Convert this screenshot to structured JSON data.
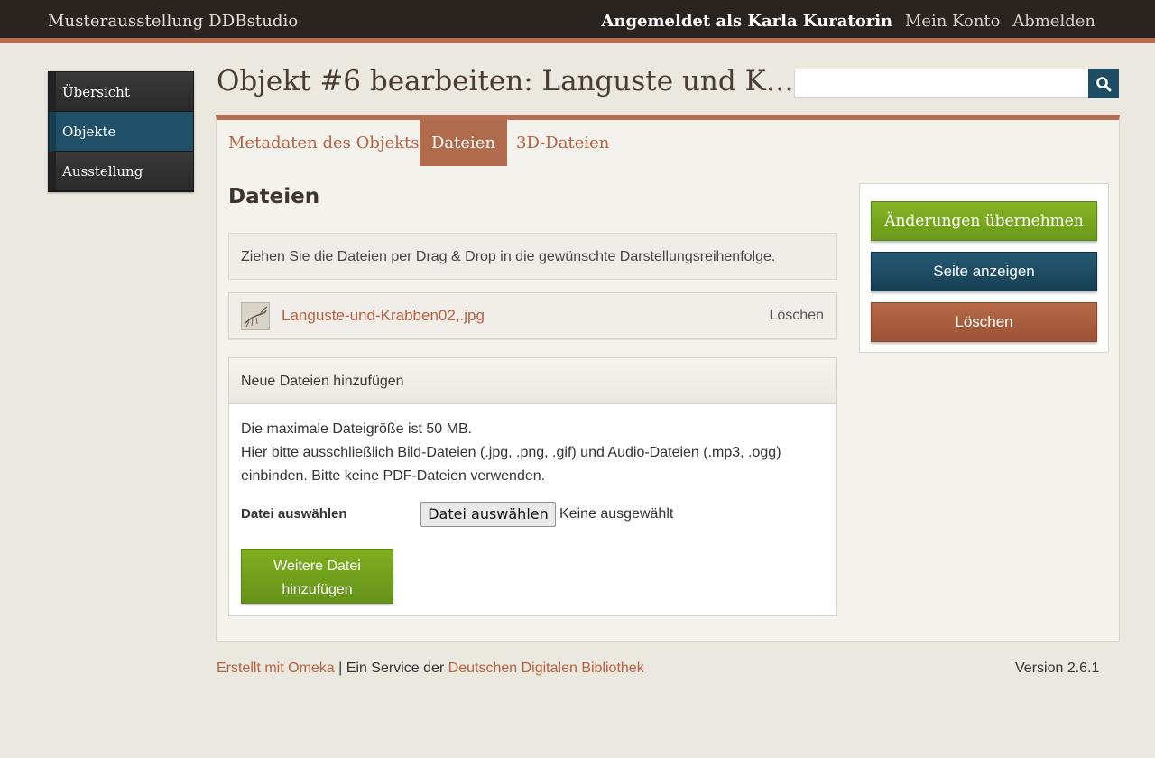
{
  "header": {
    "site_title": "Musterausstellung DDBstudio",
    "logged_in": "Angemeldet als Karla Kuratorin",
    "account": "Mein Konto",
    "logout": "Abmelden"
  },
  "sidebar": {
    "items": [
      {
        "label": "Übersicht",
        "active": false
      },
      {
        "label": "Objekte",
        "active": true
      },
      {
        "label": "Ausstellung",
        "active": false
      }
    ]
  },
  "page": {
    "title": "Objekt #6 bearbeiten: Languste und K…",
    "search_placeholder": ""
  },
  "tabs": [
    {
      "label": "Metadaten des Objekts",
      "active": false
    },
    {
      "label": "Dateien",
      "active": true
    },
    {
      "label": "3D-Dateien",
      "active": false
    }
  ],
  "files": {
    "heading": "Dateien",
    "notice": "Ziehen Sie die Dateien per Drag & Drop in die gewünschte Darstellungsreihenfolge.",
    "items": [
      {
        "name": "Languste-und-Krabben02,.jpg",
        "delete": "Löschen"
      }
    ]
  },
  "upload": {
    "heading": "Neue Dateien hinzufügen",
    "line1": "Die maximale Dateigröße ist 50 MB.",
    "line2": "Hier bitte ausschließlich Bild-Dateien (.jpg, .png, .gif) und Audio-Dateien (.mp3, .ogg) einbinden. Bitte keine PDF-Dateien verwenden.",
    "field_label": "Datei auswählen",
    "choose_button": "Datei auswählen",
    "none_selected": "Keine ausgewählt",
    "add_more_line1": "Weitere Datei",
    "add_more_line2": "hinzufügen"
  },
  "actions": {
    "save": "Änderungen übernehmen",
    "view": "Seite anzeigen",
    "delete": "Löschen"
  },
  "footer": {
    "made_with": "Erstellt mit Omeka",
    "separator": " | Ein Service der ",
    "ddb": "Deutschen Digitalen Bibliothek",
    "version": "Version 2.6.1"
  },
  "colors": {
    "accent": "#b76e4f",
    "header_bg": "#2a2420",
    "active_nav": "#1f5068",
    "link": "#b9603f",
    "green_button": "#7fae1e"
  }
}
